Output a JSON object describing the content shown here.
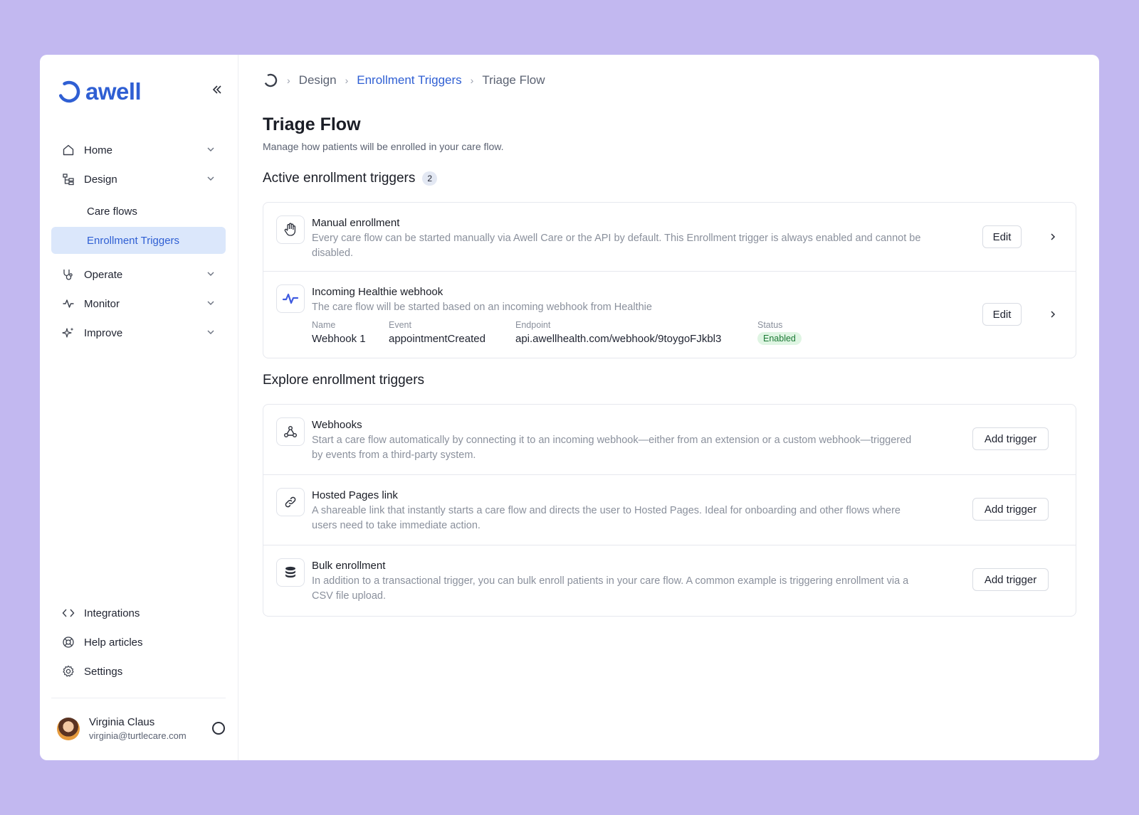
{
  "brand": {
    "name": "awell",
    "color": "#2f5fd3"
  },
  "sidebar": {
    "collapse_icon": "double-chevron-left-icon",
    "nav": [
      {
        "label": "Home",
        "icon": "home-icon"
      },
      {
        "label": "Design",
        "icon": "hierarchy-icon"
      },
      {
        "label": "Operate",
        "icon": "stethoscope-icon"
      },
      {
        "label": "Monitor",
        "icon": "activity-icon"
      },
      {
        "label": "Improve",
        "icon": "sparkles-icon"
      }
    ],
    "design_sub": [
      {
        "label": "Care flows",
        "active": false
      },
      {
        "label": "Enrollment Triggers",
        "active": true
      }
    ],
    "bottom": [
      {
        "label": "Integrations",
        "icon": "code-icon"
      },
      {
        "label": "Help articles",
        "icon": "lifebuoy-icon"
      },
      {
        "label": "Settings",
        "icon": "gear-icon"
      }
    ],
    "user": {
      "name": "Virginia Claus",
      "email": "virginia@turtlecare.com"
    }
  },
  "breadcrumb": {
    "items": [
      "Design",
      "Enrollment Triggers",
      "Triage Flow"
    ]
  },
  "page": {
    "title": "Triage Flow",
    "subtitle": "Manage how patients will be enrolled in your care flow."
  },
  "active": {
    "title": "Active enrollment triggers",
    "count": "2",
    "items": [
      {
        "title": "Manual enrollment",
        "desc": "Every care flow can be started manually via Awell Care or the API by default. This Enrollment trigger is always enabled and cannot be disabled.",
        "action": "Edit",
        "icon": "hand-icon"
      },
      {
        "title": "Incoming Healthie webhook",
        "desc": "The care flow will be started based on an incoming webhook from Healthie",
        "action": "Edit",
        "icon": "healthie-icon",
        "meta": {
          "name_label": "Name",
          "name": "Webhook 1",
          "event_label": "Event",
          "event": "appointmentCreated",
          "endpoint_label": "Endpoint",
          "endpoint": "api.awellhealth.com/webhook/9toygoFJkbl3",
          "status_label": "Status",
          "status": "Enabled"
        }
      }
    ]
  },
  "explore": {
    "title": "Explore enrollment triggers",
    "items": [
      {
        "title": "Webhooks",
        "desc": "Start a care flow automatically by connecting it to an incoming webhook—either from an extension or a custom webhook—triggered by events from a third-party system.",
        "action": "Add trigger",
        "icon": "webhook-icon"
      },
      {
        "title": "Hosted Pages link",
        "desc": "A shareable link that instantly starts a care flow and directs the user to Hosted Pages. Ideal for onboarding and other flows where users need to take immediate action.",
        "action": "Add trigger",
        "icon": "link-icon"
      },
      {
        "title": "Bulk enrollment",
        "desc": "In addition to a transactional trigger, you can bulk enroll patients in your care flow. A common example is triggering enrollment via a CSV file upload.",
        "action": "Add trigger",
        "icon": "database-icon"
      }
    ]
  }
}
